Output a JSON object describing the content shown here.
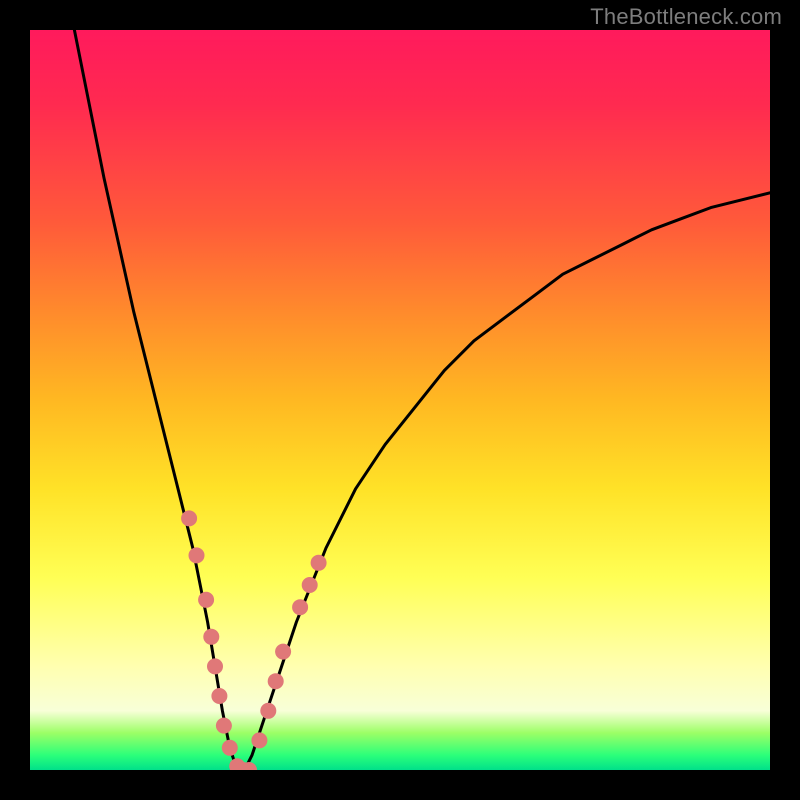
{
  "watermark": "TheBottleneck.com",
  "chart_data": {
    "type": "line",
    "title": "",
    "xlabel": "",
    "ylabel": "",
    "xlim": [
      0,
      100
    ],
    "ylim": [
      0,
      100
    ],
    "grid": false,
    "legend": false,
    "background_gradient": [
      "#ff1a5c",
      "#ff5a3a",
      "#ffb822",
      "#ffff55",
      "#f8ffd8",
      "#2cff7a"
    ],
    "series": [
      {
        "name": "bottleneck-curve",
        "color": "#000000",
        "x": [
          6,
          8,
          10,
          12,
          14,
          16,
          18,
          20,
          22,
          24,
          25,
          26,
          27,
          28,
          29,
          30,
          32,
          34,
          36,
          38,
          40,
          44,
          48,
          52,
          56,
          60,
          64,
          68,
          72,
          76,
          80,
          84,
          88,
          92,
          96,
          100
        ],
        "y": [
          100,
          90,
          80,
          71,
          62,
          54,
          46,
          38,
          30,
          20,
          14,
          8,
          3,
          0,
          0,
          2,
          8,
          14,
          20,
          25,
          30,
          38,
          44,
          49,
          54,
          58,
          61,
          64,
          67,
          69,
          71,
          73,
          74.5,
          76,
          77,
          78
        ]
      }
    ],
    "markers": [
      {
        "name": "dots-left",
        "color": "#e07878",
        "radius": 8,
        "points_xy": [
          [
            21.5,
            34
          ],
          [
            22.5,
            29
          ],
          [
            23.8,
            23
          ],
          [
            24.5,
            18
          ],
          [
            25.0,
            14
          ],
          [
            25.6,
            10
          ],
          [
            26.2,
            6
          ],
          [
            27.0,
            3
          ],
          [
            28.0,
            0.5
          ],
          [
            28.8,
            0
          ]
        ]
      },
      {
        "name": "dots-right",
        "color": "#e07878",
        "radius": 8,
        "points_xy": [
          [
            29.6,
            0
          ],
          [
            31.0,
            4
          ],
          [
            32.2,
            8
          ],
          [
            33.2,
            12
          ],
          [
            34.2,
            16
          ],
          [
            36.5,
            22
          ],
          [
            37.8,
            25
          ],
          [
            39.0,
            28
          ]
        ]
      }
    ]
  }
}
